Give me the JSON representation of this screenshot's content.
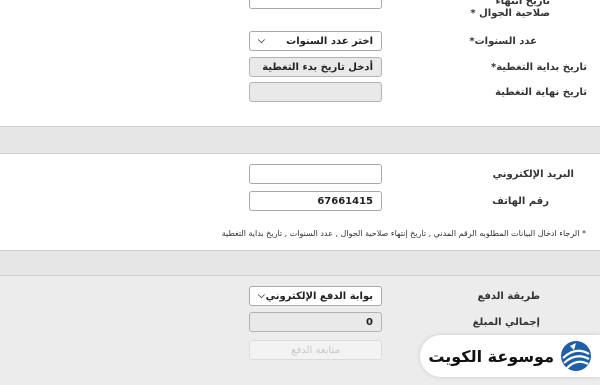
{
  "top_section": {
    "phone_expiry_label": "تاريخ انتهاء صلاحية الجوال *",
    "phone_expiry_value": "",
    "years_label": "عدد السنوات*",
    "years_select_value": "اختر عدد السنوات",
    "coverage_start_label": "تاريخ بداية التغطية*",
    "coverage_start_value": "أدخل تاريخ بدء التغطية",
    "coverage_end_label": "تاريخ نهاية التغطية",
    "coverage_end_value": ""
  },
  "contact_section": {
    "email_label": "البريد الإلكتروني",
    "email_value": "",
    "phone_label": "رقم الهاتف",
    "phone_value": "67661415",
    "note": "* الرجاء ادخال البيانات المطلوبه الرقم المدني , تاريخ إنتهاء صلاحية الجوال , عدد السنوات , تاريخ بداية التغطية"
  },
  "payment_section": {
    "method_label": "طريقة الدفع",
    "method_select_value": "بوابة الدفع الإلكتروني",
    "total_label": "إجمالي المبلغ",
    "total_value": "0",
    "submit_label": "متابعة الدفع"
  },
  "watermark": {
    "text": "موسوعة الكويت",
    "icon": "globe-icon"
  }
}
